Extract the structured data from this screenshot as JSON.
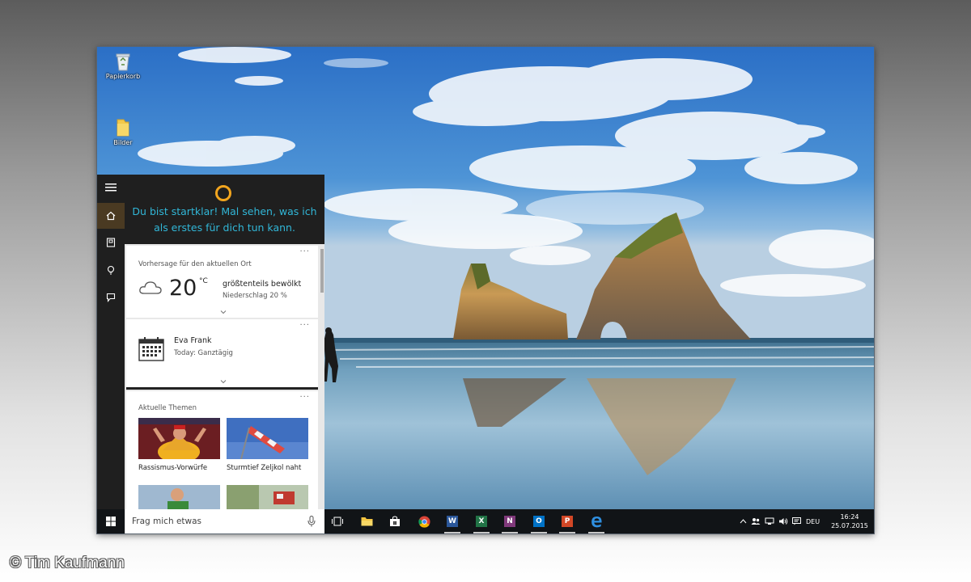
{
  "desktop": {
    "icons": [
      {
        "label": "Papierkorb",
        "icon": "recycle-bin-icon"
      },
      {
        "label": "Bilder",
        "icon": "folder-icon"
      }
    ]
  },
  "cortana": {
    "rail": [
      "hamburger-menu-icon",
      "home-icon",
      "notebook-icon",
      "lightbulb-icon",
      "feedback-icon"
    ],
    "greeting": "Du bist startklar! Mal sehen, was ich als erstes für dich tun kann.",
    "weather": {
      "header": "Vorhersage für den aktuellen Ort",
      "temp": "20",
      "unit": "°C",
      "condition": "größtenteils bewölkt",
      "precip": "Niederschlag 20 %"
    },
    "calendar": {
      "name": "Eva Frank",
      "detail": "Today: Ganztägig"
    },
    "news": {
      "header": "Aktuelle Themen",
      "items": [
        {
          "title": "Rassismus-Vorwürfe"
        },
        {
          "title": "Sturmtief Zeljkol naht"
        }
      ]
    },
    "more": "···"
  },
  "taskbar": {
    "search_placeholder": "Frag mich etwas",
    "apps": [
      "task-view-icon",
      "file-explorer-icon",
      "store-icon",
      "chrome-icon",
      "word-icon",
      "excel-icon",
      "onenote-icon",
      "outlook-icon",
      "powerpoint-icon",
      "edge-icon"
    ],
    "tiles": {
      "word": "W",
      "excel": "X",
      "onenote": "N",
      "outlook": "O",
      "powerpoint": "P"
    },
    "language": "DEU",
    "time": "16:24",
    "date": "25.07.2015"
  },
  "credit": "© Tim Kaufmann",
  "colors": {
    "accent": "#31b7d8",
    "cortana_ring": "#f2a51e",
    "panel_dark": "#1f1f1f",
    "taskbar": "#111417"
  }
}
